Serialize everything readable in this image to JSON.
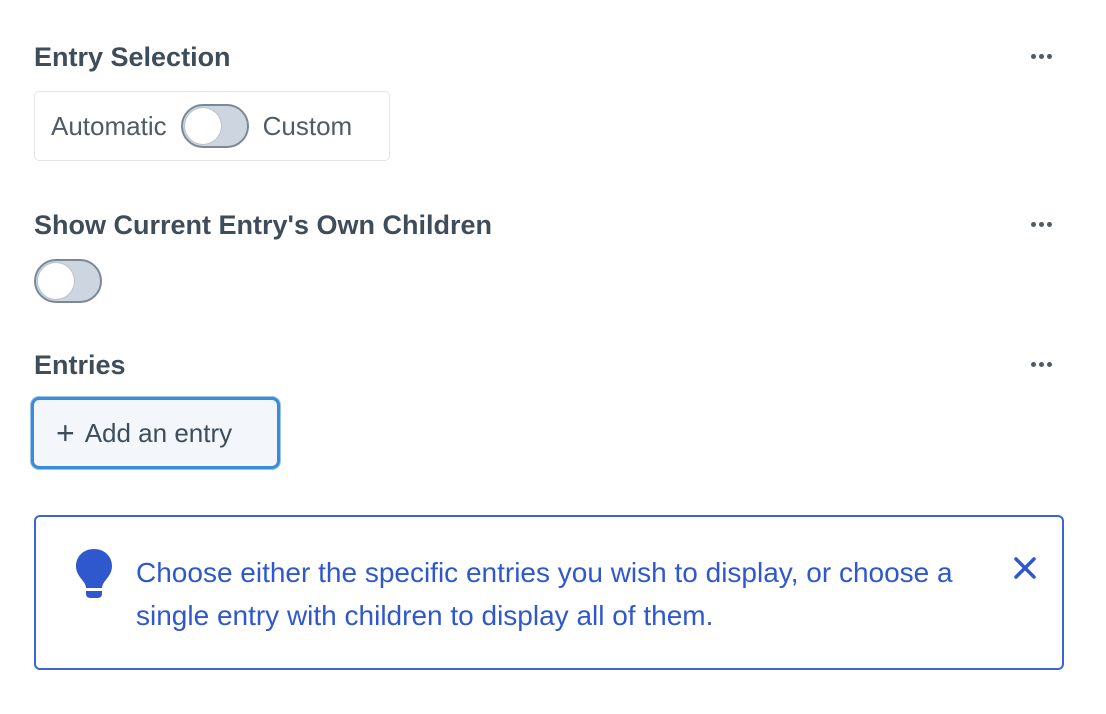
{
  "entry_selection": {
    "heading": "Entry Selection",
    "option_left": "Automatic",
    "option_right": "Custom",
    "toggle_on": false
  },
  "show_children": {
    "heading": "Show Current Entry's Own Children",
    "toggle_on": false
  },
  "entries": {
    "heading": "Entries",
    "add_button_label": "Add an entry"
  },
  "notice": {
    "text": "Choose either the specific entries you wish to display, or choose a single entry with children to display all of them.",
    "icon": "lightbulb-icon"
  },
  "colors": {
    "accent": "#3b8cd6",
    "notice_blue": "#2f58cf",
    "text": "#3f4d5a",
    "toggle_bg": "#cdd6e0"
  }
}
